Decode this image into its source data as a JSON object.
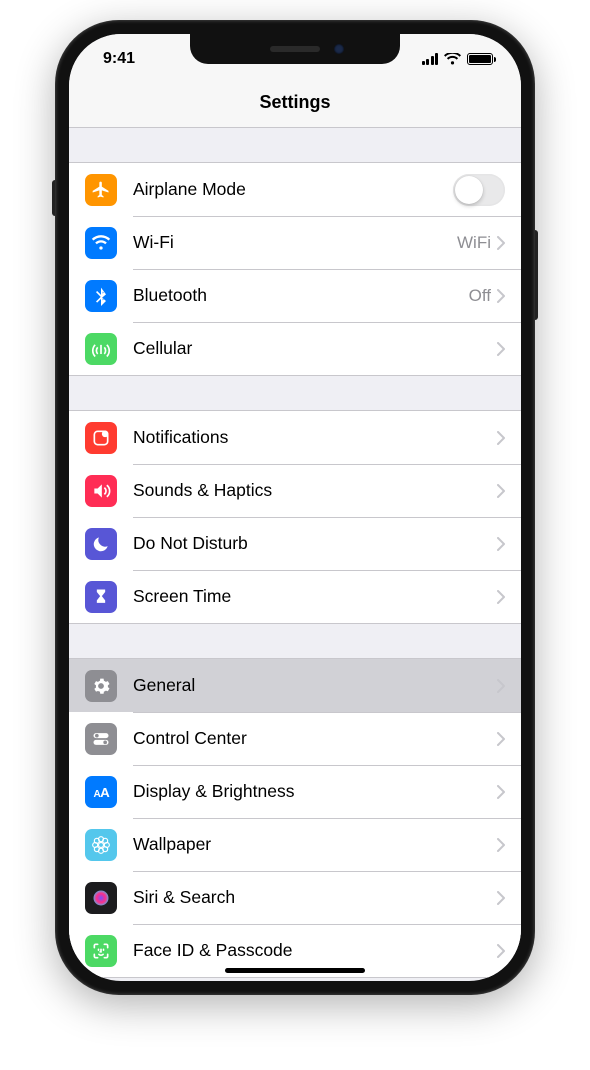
{
  "status": {
    "time": "9:41"
  },
  "title": "Settings",
  "sections": [
    {
      "rows": [
        {
          "id": "airplane",
          "label": "Airplane Mode",
          "icon": "airplane",
          "color": "#ff9500",
          "type": "toggle",
          "toggle_on": false
        },
        {
          "id": "wifi",
          "label": "Wi-Fi",
          "icon": "wifi",
          "color": "#007aff",
          "type": "link",
          "value": "WiFi"
        },
        {
          "id": "bluetooth",
          "label": "Bluetooth",
          "icon": "bluetooth",
          "color": "#007aff",
          "type": "link",
          "value": "Off"
        },
        {
          "id": "cellular",
          "label": "Cellular",
          "icon": "cellular",
          "color": "#4cd964",
          "type": "link"
        }
      ]
    },
    {
      "rows": [
        {
          "id": "notifications",
          "label": "Notifications",
          "icon": "notifications",
          "color": "#ff3b30",
          "type": "link"
        },
        {
          "id": "sounds",
          "label": "Sounds & Haptics",
          "icon": "sounds",
          "color": "#ff2d55",
          "type": "link"
        },
        {
          "id": "dnd",
          "label": "Do Not Disturb",
          "icon": "moon",
          "color": "#5856d6",
          "type": "link"
        },
        {
          "id": "screentime",
          "label": "Screen Time",
          "icon": "hourglass",
          "color": "#5856d6",
          "type": "link"
        }
      ]
    },
    {
      "rows": [
        {
          "id": "general",
          "label": "General",
          "icon": "gear",
          "color": "#8e8e93",
          "type": "link",
          "selected": true
        },
        {
          "id": "controlcenter",
          "label": "Control Center",
          "icon": "switches",
          "color": "#8e8e93",
          "type": "link"
        },
        {
          "id": "display",
          "label": "Display & Brightness",
          "icon": "aa",
          "color": "#007aff",
          "type": "link"
        },
        {
          "id": "wallpaper",
          "label": "Wallpaper",
          "icon": "flower",
          "color": "#54c7ec",
          "type": "link"
        },
        {
          "id": "siri",
          "label": "Siri & Search",
          "icon": "siri",
          "color": "#1c1c1e",
          "type": "link"
        },
        {
          "id": "faceid",
          "label": "Face ID & Passcode",
          "icon": "face",
          "color": "#4cd964",
          "type": "link"
        }
      ]
    }
  ]
}
